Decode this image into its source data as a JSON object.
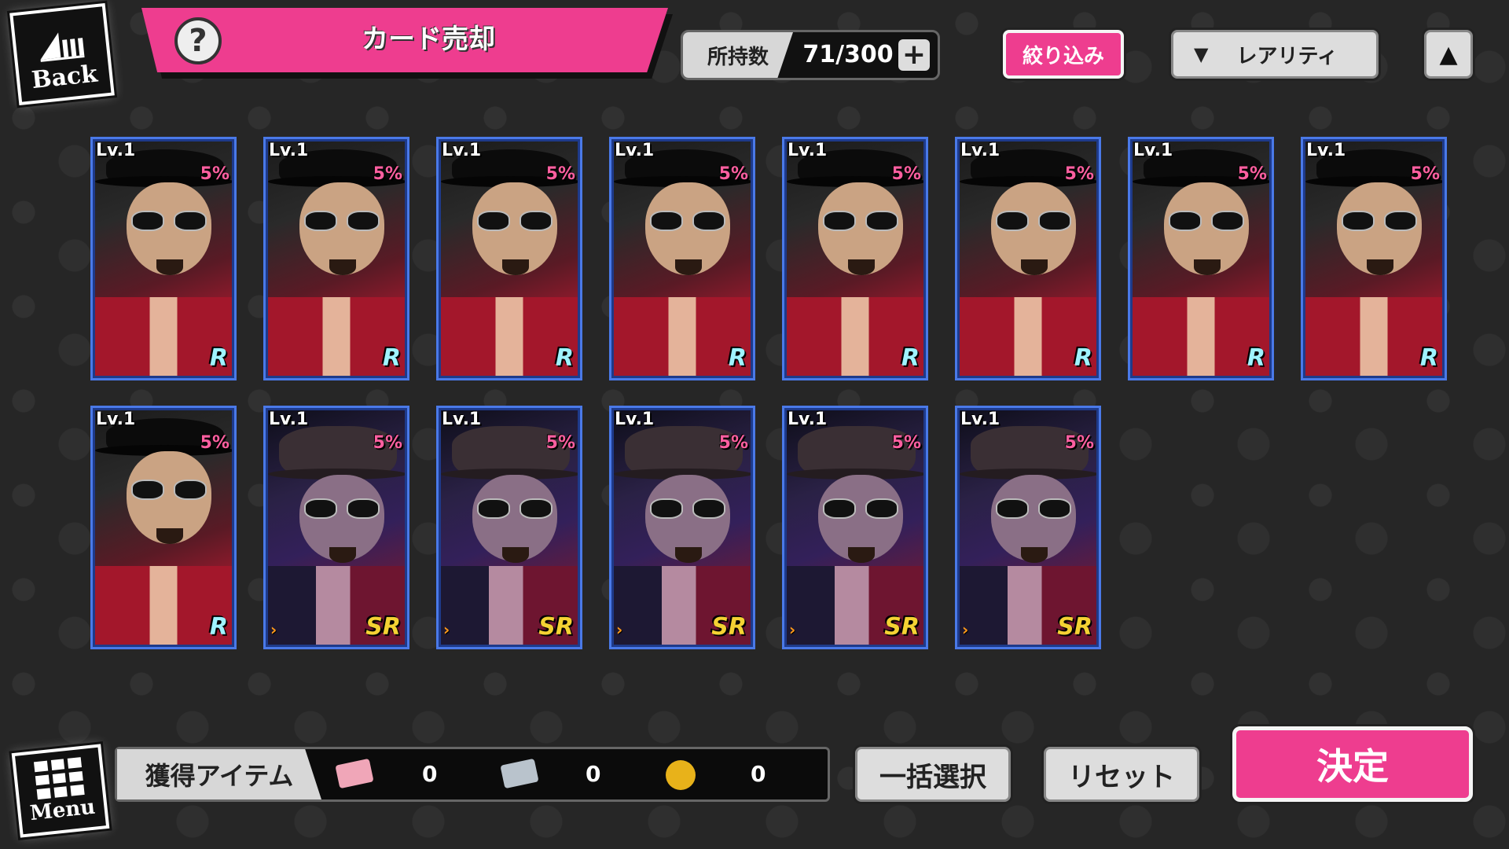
{
  "nav": {
    "back_label": "Back",
    "menu_label": "Menu"
  },
  "header": {
    "title": "カード売却",
    "help_symbol": "?"
  },
  "owned": {
    "label": "所持数",
    "value": "71/300",
    "add_symbol": "+"
  },
  "toolbar": {
    "filter_label": "絞り込み",
    "sort_label": "レアリティ",
    "sort_caret": "▼",
    "sort_order_symbol": "▲"
  },
  "cards": [
    {
      "level": "Lv.1",
      "percent": "5%",
      "rarity": "R",
      "style": "rare"
    },
    {
      "level": "Lv.1",
      "percent": "5%",
      "rarity": "R",
      "style": "rare"
    },
    {
      "level": "Lv.1",
      "percent": "5%",
      "rarity": "R",
      "style": "rare"
    },
    {
      "level": "Lv.1",
      "percent": "5%",
      "rarity": "R",
      "style": "rare"
    },
    {
      "level": "Lv.1",
      "percent": "5%",
      "rarity": "R",
      "style": "rare"
    },
    {
      "level": "Lv.1",
      "percent": "5%",
      "rarity": "R",
      "style": "rare"
    },
    {
      "level": "Lv.1",
      "percent": "5%",
      "rarity": "R",
      "style": "rare"
    },
    {
      "level": "Lv.1",
      "percent": "5%",
      "rarity": "R",
      "style": "rare"
    },
    {
      "level": "Lv.1",
      "percent": "5%",
      "rarity": "R",
      "style": "rare"
    },
    {
      "level": "Lv.1",
      "percent": "5%",
      "rarity": "SR",
      "style": "superrare"
    },
    {
      "level": "Lv.1",
      "percent": "5%",
      "rarity": "SR",
      "style": "superrare"
    },
    {
      "level": "Lv.1",
      "percent": "5%",
      "rarity": "SR",
      "style": "superrare"
    },
    {
      "level": "Lv.1",
      "percent": "5%",
      "rarity": "SR",
      "style": "superrare"
    },
    {
      "level": "Lv.1",
      "percent": "5%",
      "rarity": "SR",
      "style": "superrare"
    }
  ],
  "items": {
    "label": "獲得アイテム",
    "entries": [
      {
        "icon": "pink-ticket-icon",
        "count": "0",
        "color": "#f0a6b8"
      },
      {
        "icon": "silver-ticket-icon",
        "count": "0",
        "color": "#b9c3cc"
      },
      {
        "icon": "gold-coin-icon",
        "count": "0",
        "color": "#e8b21a"
      }
    ]
  },
  "actions": {
    "select_all_label": "一括選択",
    "reset_label": "リセット",
    "confirm_label": "決定"
  },
  "colors": {
    "accent_pink": "#ee3d8f",
    "card_border": "#4a79e8",
    "background": "#262626"
  }
}
